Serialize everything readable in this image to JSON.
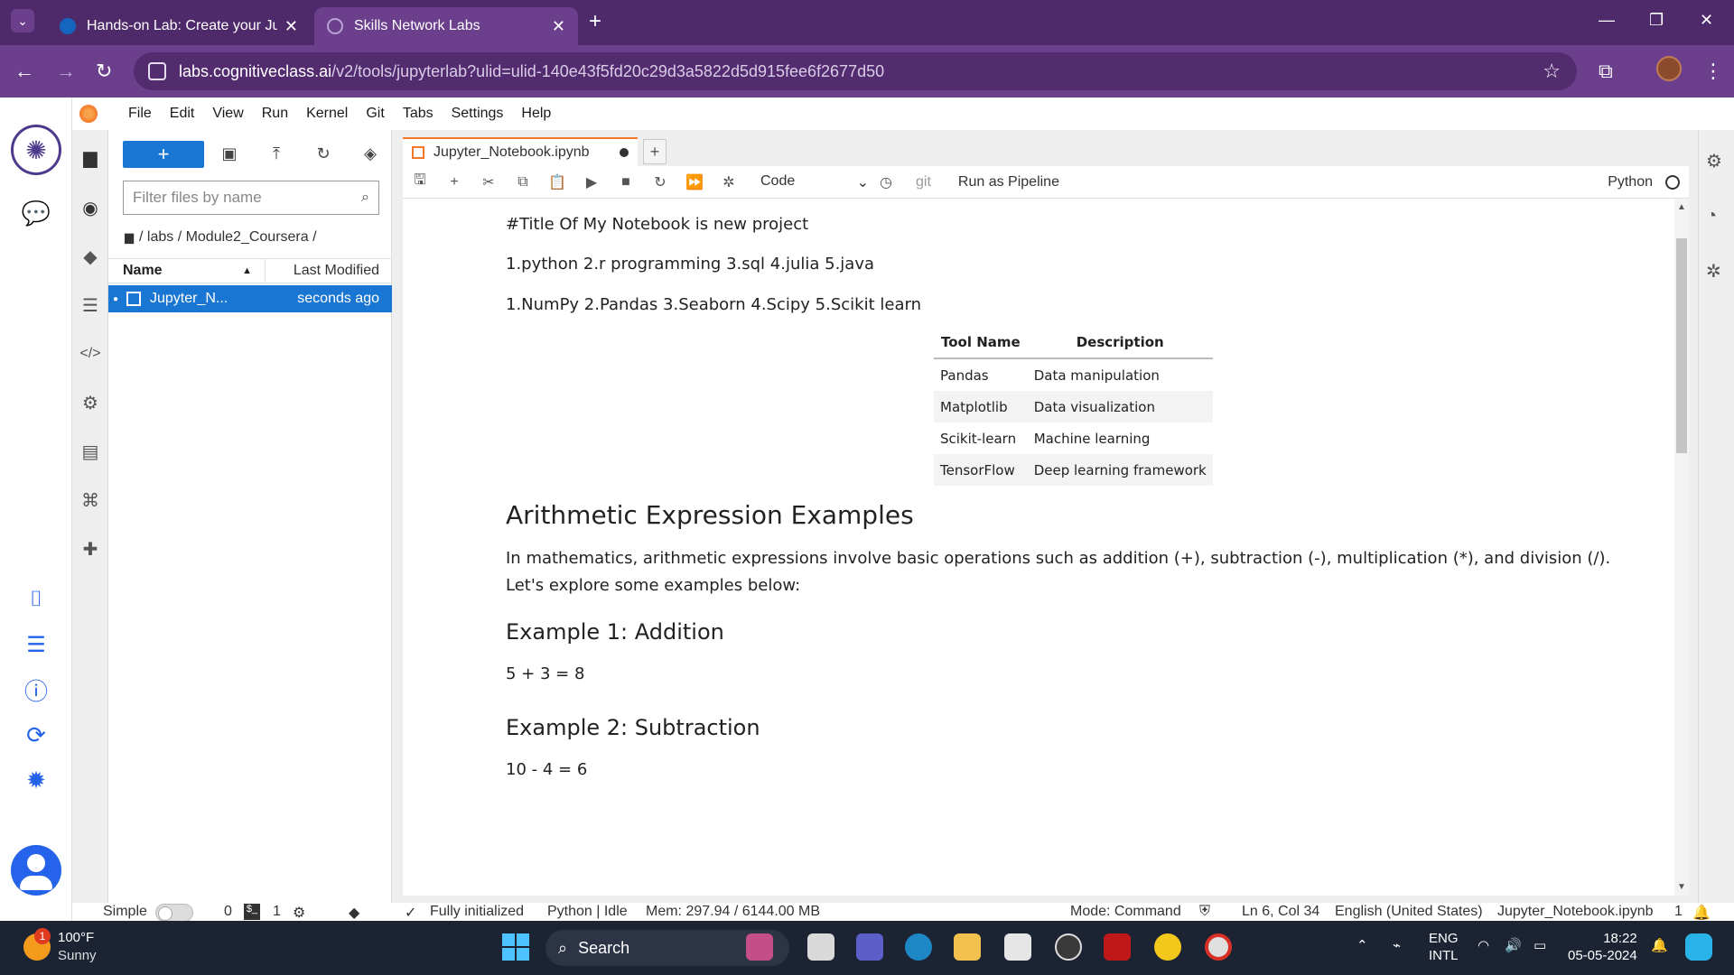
{
  "browser": {
    "tabs": [
      {
        "title": "Hands-on Lab: Create your Jupy",
        "favicon_color": "#1565c0",
        "active": false
      },
      {
        "title": "Skills Network Labs",
        "favicon_color": "#8b6bb8",
        "active": true
      }
    ],
    "url_host": "labs.cognitiveclass.ai",
    "url_path": "/v2/tools/jupyterlab?ulid=ulid-140e43f5fd20c29d3a5822d5d915fee6f2677d50"
  },
  "menu": [
    "File",
    "Edit",
    "View",
    "Run",
    "Kernel",
    "Git",
    "Tabs",
    "Settings",
    "Help"
  ],
  "filebrowser": {
    "filter_placeholder": "Filter files by name",
    "breadcrumb": "/ labs / Module2_Coursera /",
    "col_name": "Name",
    "col_modified": "Last Modified",
    "files": [
      {
        "name": "Jupyter_N...",
        "modified": "seconds ago"
      }
    ]
  },
  "notebook": {
    "tab_name": "Jupyter_Notebook.ipynb",
    "cell_type": "Code",
    "git_label": "git",
    "pipeline_label": "Run as Pipeline",
    "kernel": "Python",
    "cells": {
      "title_line": "#Title Of My Notebook is new project",
      "languages": "1.python 2.r programming 3.sql 4.julia 5.java",
      "libraries": "1.NumPy 2.Pandas 3.Seaborn 4.Scipy 5.Scikit learn",
      "table": {
        "headers": [
          "Tool Name",
          "Description"
        ],
        "rows": [
          [
            "Pandas",
            "Data manipulation"
          ],
          [
            "Matplotlib",
            "Data visualization"
          ],
          [
            "Scikit-learn",
            "Machine learning"
          ],
          [
            "TensorFlow",
            "Deep learning framework"
          ]
        ]
      },
      "heading": "Arithmetic Expression Examples",
      "intro": "In mathematics, arithmetic expressions involve basic operations such as addition (+), subtraction (-), multiplication (*), and division (/). Let's explore some examples below:",
      "ex1_title": "Example 1: Addition",
      "ex1_body": "5 + 3 = 8",
      "ex2_title": "Example 2: Subtraction",
      "ex2_body": "10 - 4 = 6"
    }
  },
  "status": {
    "simple": "Simple",
    "count_a": "0",
    "count_b": "1",
    "init": "Fully initialized",
    "kernel_state": "Python | Idle",
    "mem": "Mem: 297.94 / 6144.00 MB",
    "mode": "Mode: Command",
    "cursor": "Ln 6, Col 34",
    "lang": "English (United States)",
    "file": "Jupyter_Notebook.ipynb",
    "notif": "1"
  },
  "taskbar": {
    "temp": "100°F",
    "weather": "Sunny",
    "weather_badge": "1",
    "search": "Search",
    "lang_1": "ENG",
    "lang_2": "INTL",
    "time": "18:22",
    "date": "05-05-2024"
  }
}
